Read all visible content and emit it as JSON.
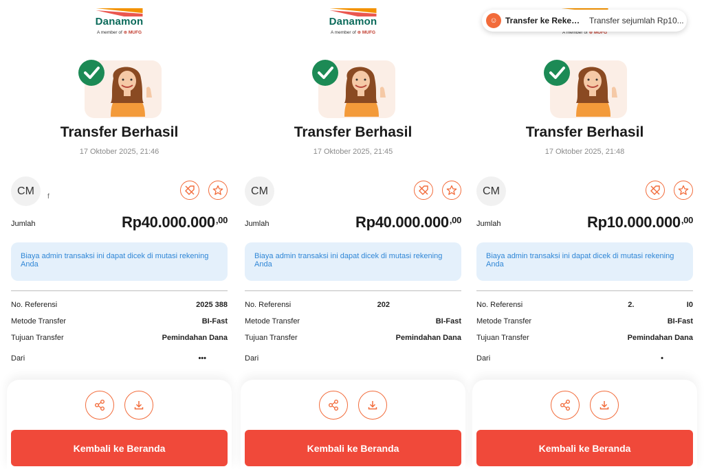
{
  "brand": {
    "name": "Danamon",
    "member_prefix": "A member of",
    "member_brand": "MUFG"
  },
  "screens": [
    {
      "status_title": "Transfer Berhasil",
      "datetime": "17 Oktober 2025, 21:46",
      "avatar_initials": "CM",
      "recipient_partial": "f",
      "amount_label": "Jumlah",
      "amount_main": "Rp40.000.000",
      "amount_cents": ",00",
      "admin_note": "Biaya admin transaksi ini dapat dicek di mutasi rekening Anda",
      "details": [
        {
          "label": "No. Referensi",
          "value": "2025                    388"
        },
        {
          "label": "Metode Transfer",
          "value": "BI-Fast"
        },
        {
          "label": "Tujuan Transfer",
          "value": "Pemindahan Dana"
        },
        {
          "label": "Dari",
          "value": "•••"
        }
      ],
      "cta_label": "Kembali ke Beranda"
    },
    {
      "status_title": "Transfer Berhasil",
      "datetime": "17 Oktober 2025, 21:45",
      "avatar_initials": "CM",
      "recipient_partial": "",
      "amount_label": "Jumlah",
      "amount_main": "Rp40.000.000",
      "amount_cents": ",00",
      "admin_note": "Biaya admin transaksi ini dapat dicek di mutasi rekening Anda",
      "details": [
        {
          "label": "No. Referensi",
          "value": "202"
        },
        {
          "label": "Metode Transfer",
          "value": "BI-Fast"
        },
        {
          "label": "Tujuan Transfer",
          "value": "Pemindahan Dana"
        },
        {
          "label": "Dari",
          "value": ""
        }
      ],
      "cta_label": "Kembali ke Beranda"
    },
    {
      "status_title": "Transfer Berhasil",
      "datetime": "17 Oktober 2025, 21:48",
      "avatar_initials": "CM",
      "recipient_partial": "",
      "amount_label": "Jumlah",
      "amount_main": "Rp10.000.000",
      "amount_cents": ",00",
      "admin_note": "Biaya admin transaksi ini dapat dicek di mutasi rekening Anda",
      "details": [
        {
          "label": "No. Referensi",
          "value": "2.                         I0"
        },
        {
          "label": "Metode Transfer",
          "value": "BI-Fast"
        },
        {
          "label": "Tujuan Transfer",
          "value": "Pemindahan Dana"
        },
        {
          "label": "Dari",
          "value": "•"
        }
      ],
      "cta_label": "Kembali ke Beranda",
      "notification": {
        "title": "Transfer ke Rekeni...",
        "body": "Transfer sejumlah Rp10..."
      }
    }
  ],
  "colors": {
    "accent": "#f0493a",
    "brand_green": "#0b6a5a",
    "info_bg": "#e4f0fb",
    "info_text": "#2f86d6"
  },
  "icons": [
    "checkmark-badge-icon",
    "favorite-tag-icon",
    "star-icon",
    "share-icon",
    "download-icon",
    "notification-app-icon"
  ]
}
